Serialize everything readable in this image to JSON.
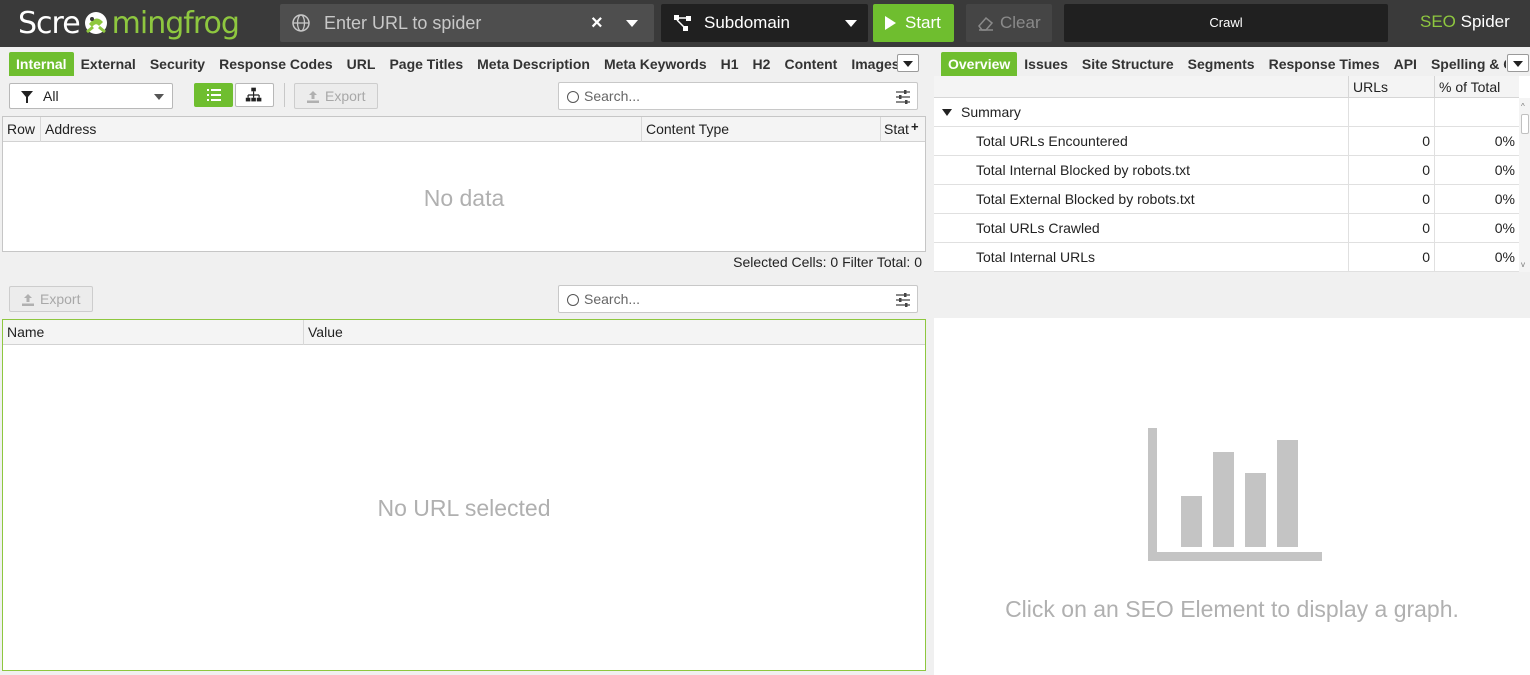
{
  "header": {
    "logo_left": "Scre",
    "logo_right": "mingfrog",
    "url_placeholder": "Enter URL to spider",
    "mode": "Subdomain",
    "start_label": "Start",
    "clear_label": "Clear",
    "crawl_status": "Crawl",
    "brand_seo": "SEO",
    "brand_spider": " Spider"
  },
  "left_tabs": [
    "Internal",
    "External",
    "Security",
    "Response Codes",
    "URL",
    "Page Titles",
    "Meta Description",
    "Meta Keywords",
    "H1",
    "H2",
    "Content",
    "Images"
  ],
  "right_tabs": [
    "Overview",
    "Issues",
    "Site Structure",
    "Segments",
    "Response Times",
    "API",
    "Spelling & Gr"
  ],
  "toolbar": {
    "filter_value": "All",
    "export_label": "Export",
    "search_placeholder": "Search..."
  },
  "main_table": {
    "columns": [
      "Row",
      "Address",
      "Content Type",
      "Stat"
    ],
    "empty_text": "No data",
    "selected_cells_label": "Selected Cells:",
    "selected_cells_value": "0",
    "filter_total_label": "Filter Total:",
    "filter_total_value": "0"
  },
  "detail_toolbar": {
    "export_label": "Export",
    "search_placeholder": "Search..."
  },
  "detail_table": {
    "columns": [
      "Name",
      "Value"
    ],
    "empty_text": "No URL selected"
  },
  "overview": {
    "columns": [
      "URLs",
      "% of Total"
    ],
    "summary_label": "Summary",
    "rows": [
      {
        "label": "Total URLs Encountered",
        "urls": "0",
        "pct": "0%"
      },
      {
        "label": "Total Internal Blocked by robots.txt",
        "urls": "0",
        "pct": "0%"
      },
      {
        "label": "Total External Blocked by robots.txt",
        "urls": "0",
        "pct": "0%"
      },
      {
        "label": "Total URLs Crawled",
        "urls": "0",
        "pct": "0%"
      },
      {
        "label": "Total Internal URLs",
        "urls": "0",
        "pct": "0%"
      }
    ]
  },
  "graph": {
    "message": "Click on an SEO Element to display a graph.",
    "icon": "bar-chart-icon"
  },
  "colors": {
    "accent_green": "#6fbe2f",
    "logo_green": "#8ec73f",
    "topbar_bg": "#3a3a3a"
  }
}
